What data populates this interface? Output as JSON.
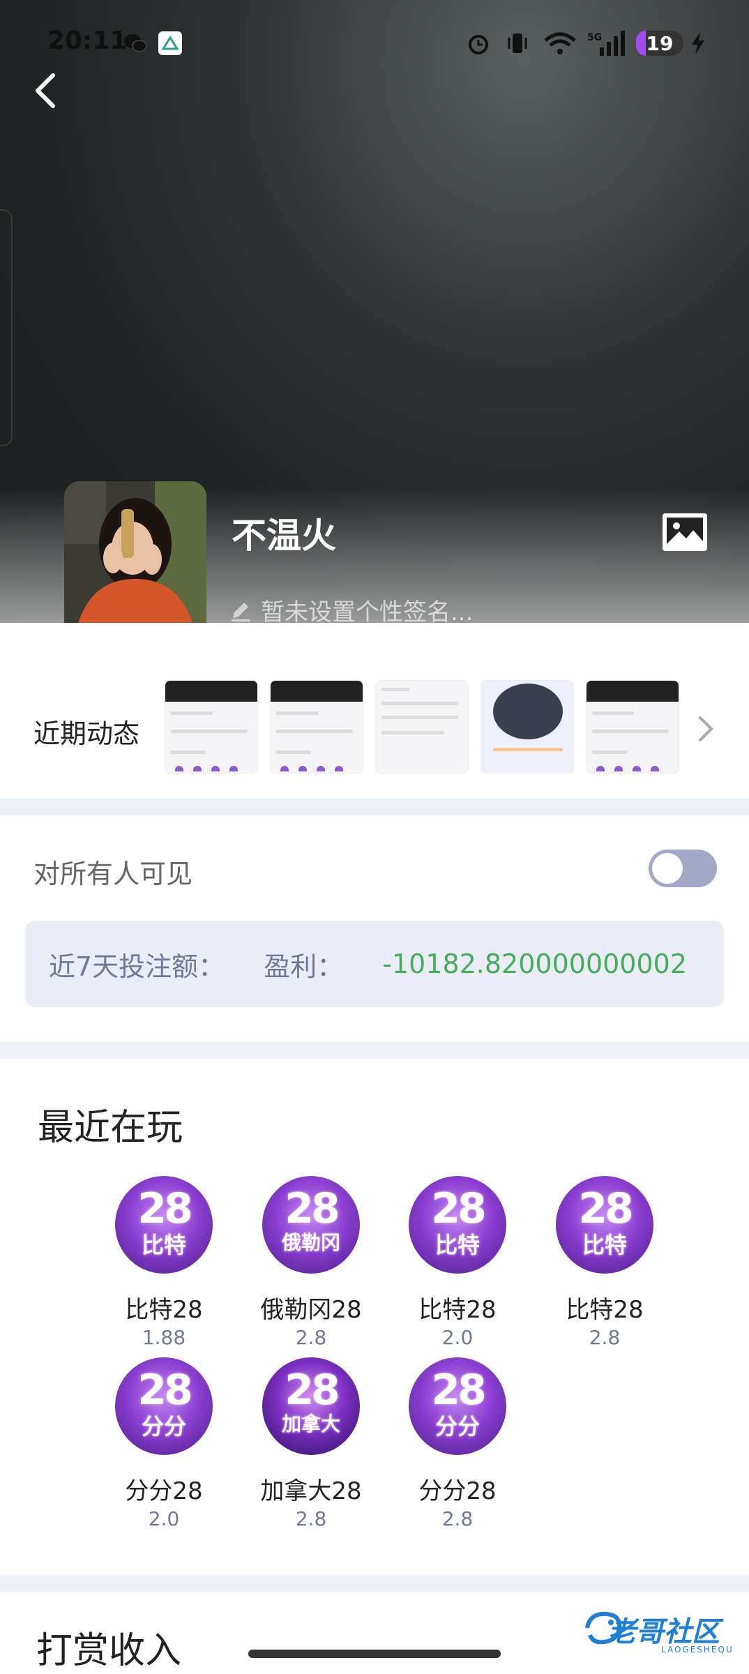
{
  "status_bar": {
    "time": "20:11",
    "battery": "19"
  },
  "profile": {
    "username": "不温火",
    "bio_placeholder": "暂未设置个性签名..."
  },
  "recent": {
    "title": "近期动态"
  },
  "visibility": {
    "label": "对所有人可见",
    "enabled": false
  },
  "stats": {
    "bet_label": "近7天投注额：",
    "profit_label": "盈利：",
    "profit_value": "-10182.820000000002"
  },
  "games": {
    "title": "最近在玩",
    "items": [
      {
        "icon_num": "28",
        "icon_tag": "比特",
        "name": "比特28",
        "odds": "1.88"
      },
      {
        "icon_num": "28",
        "icon_tag": "俄勒冈",
        "name": "俄勒冈28",
        "odds": "2.8"
      },
      {
        "icon_num": "28",
        "icon_tag": "比特",
        "name": "比特28",
        "odds": "2.0"
      },
      {
        "icon_num": "28",
        "icon_tag": "比特",
        "name": "比特28",
        "odds": "2.8"
      },
      {
        "icon_num": "28",
        "icon_tag": "分分",
        "name": "分分28",
        "odds": "2.0"
      },
      {
        "icon_num": "28",
        "icon_tag": "加拿大",
        "name": "加拿大28",
        "odds": "2.8"
      },
      {
        "icon_num": "28",
        "icon_tag": "分分",
        "name": "分分28",
        "odds": "2.8"
      }
    ]
  },
  "bottom_section": {
    "title": "打赏收入"
  },
  "watermark": {
    "text": "老哥社区",
    "sub": "LAOGESHEQU"
  },
  "colors": {
    "profit": "#46ad5c",
    "toggle_off": "#a3a8c6",
    "stats_bg": "#ebedf6"
  }
}
